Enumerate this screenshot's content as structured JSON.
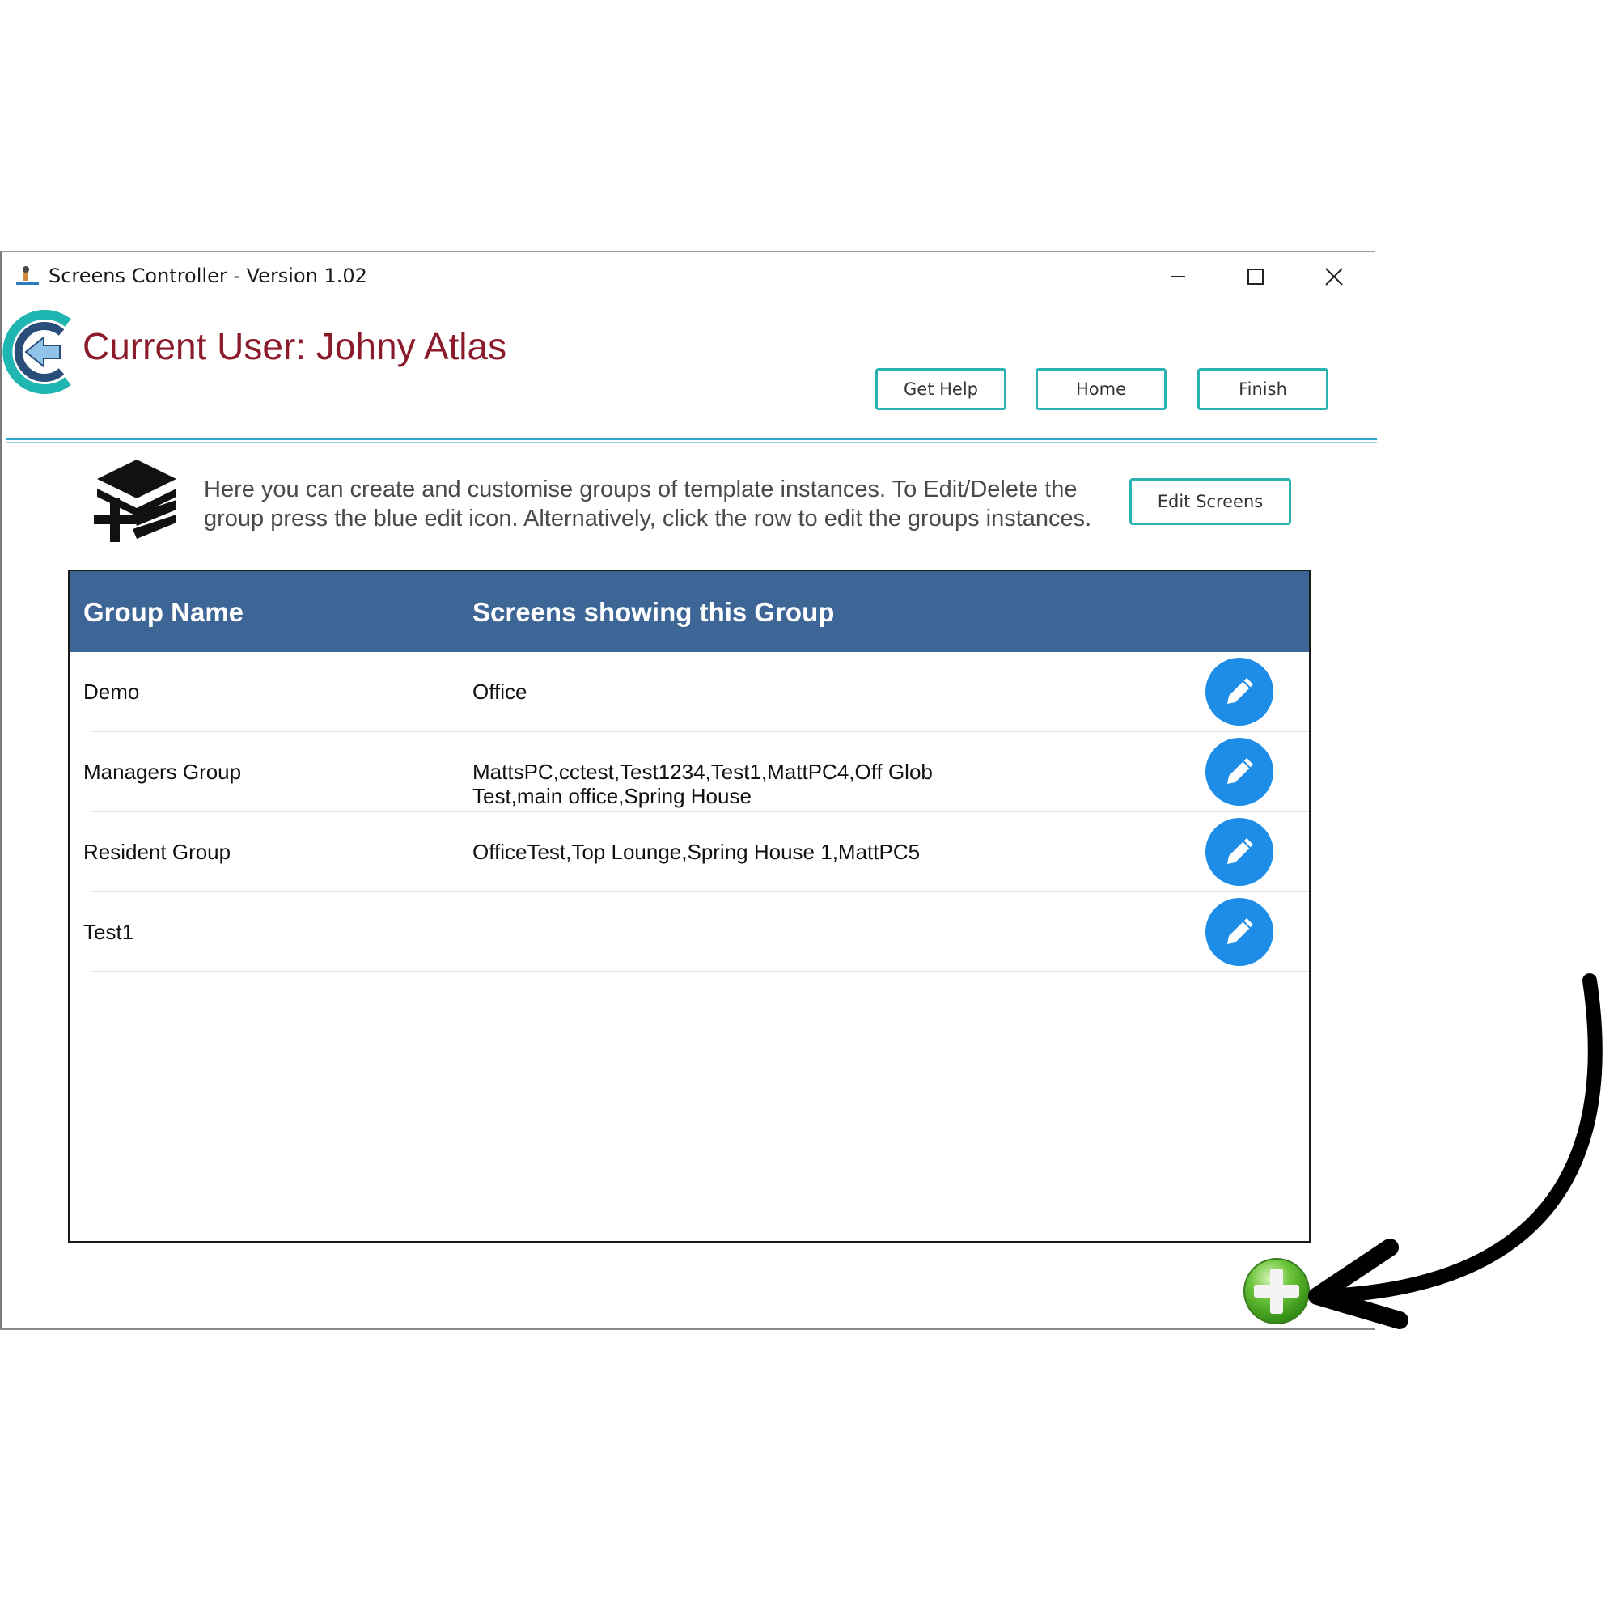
{
  "window": {
    "title": "Screens Controller - Version 1.02"
  },
  "header": {
    "user_title": "Current User: Johny Atlas",
    "buttons": {
      "help": "Get Help",
      "home": "Home",
      "finish": "Finish"
    }
  },
  "info": {
    "text": "Here you can create and customise groups of template instances. To Edit/Delete the group press the blue edit icon. Alternatively, click the row to edit the groups instances.",
    "edit_screens_label": "Edit Screens"
  },
  "table": {
    "columns": [
      "Group Name",
      "Screens showing this Group"
    ],
    "rows": [
      {
        "name": "Demo",
        "screens": "Office"
      },
      {
        "name": "Managers Group",
        "screens": "MattsPC,cctest,Test1234,Test1,MattPC4,Off Glob Test,main office,Spring House"
      },
      {
        "name": "Resident Group",
        "screens": "OfficeTest,Top Lounge,Spring House 1,MattPC5"
      },
      {
        "name": "Test1",
        "screens": ""
      }
    ]
  },
  "colors": {
    "header_bg": "#3d6596",
    "accent": "#2bb3b3",
    "user_title": "#8b1a2b",
    "edit_button": "#1e8de8",
    "add_button": "#4caf2a"
  },
  "icons": {
    "add": "green-plus-circle-icon",
    "edit": "pencil-icon",
    "arrow": "curved-arrow-annotation"
  }
}
